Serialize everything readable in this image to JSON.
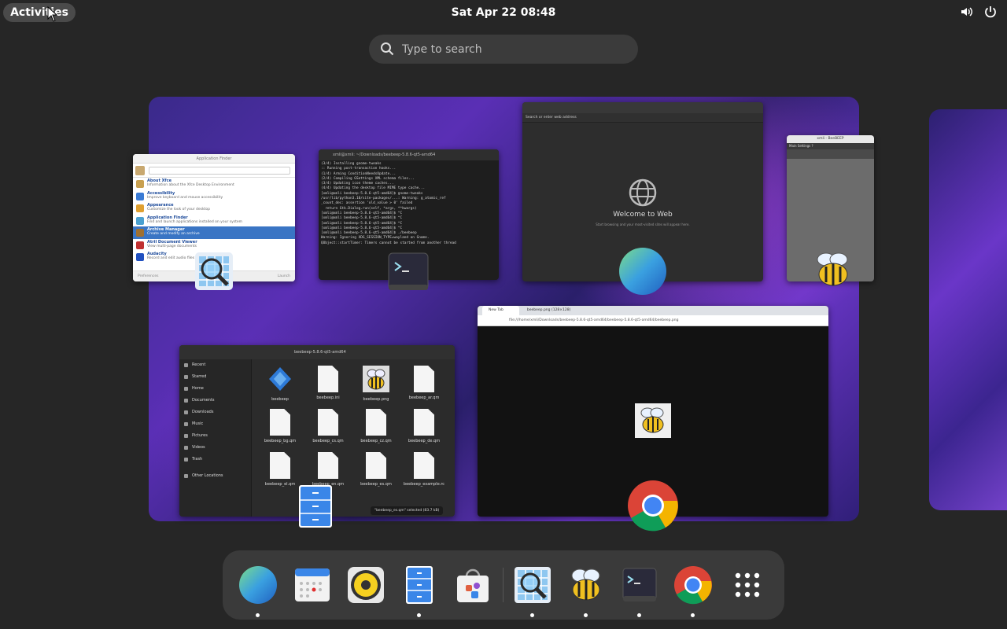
{
  "topbar": {
    "activities_label": "Activities",
    "clock": "Sat Apr 22  08:48",
    "icons": [
      "volume-icon",
      "power-icon"
    ]
  },
  "search": {
    "placeholder": "Type to search"
  },
  "windows": {
    "app_finder": {
      "title": "Application Finder",
      "items": [
        {
          "name": "About Xfce",
          "desc": "Information about the Xfce Desktop Environment",
          "color": "#c8a050"
        },
        {
          "name": "Accessibility",
          "desc": "Improve keyboard and mouse accessibility",
          "color": "#3a7bd5"
        },
        {
          "name": "Appearance",
          "desc": "Customize the look of your desktop",
          "color": "#e0a030"
        },
        {
          "name": "Application Finder",
          "desc": "Find and launch applications installed on your system",
          "color": "#4aa0d0"
        },
        {
          "name": "Archive Manager",
          "desc": "Create and modify an archive",
          "color": "#a07030"
        },
        {
          "name": "Atril Document Viewer",
          "desc": "View multi-page documents",
          "color": "#c03030"
        },
        {
          "name": "Audacity",
          "desc": "Record and edit audio files",
          "color": "#2050c0"
        }
      ],
      "selected_index": 4,
      "footer_left": "Preferences",
      "footer_right": "Launch"
    },
    "terminal": {
      "title": "xmli@xmli: ~/Downloads/beebeep-5.8.6-qt5-amd64",
      "lines": [
        "(3/4) Installing gnome-tweaks",
        ":: Running post-transaction hooks...",
        "(1/4) Arming ConditionNeedsUpdate...",
        "(2/4) Compiling GSettings XML schema files...",
        "(3/4) Updating icon theme caches...",
        "(4/4) Updating the desktop file MIME type cache...",
        "[xmli@xmli beebeep-5.8.6-qt5-amd64]$ gnome-tweaks",
        "/usr/lib/python3.10/site-packages/...: Warning: g_atomic_ref",
        "_count_dec: assertion 'old_value > 0' failed",
        "  return Gtk.Dialog.run(self, *args, **kwargs)",
        "[xmli@xmli beebeep-5.8.6-qt5-amd64]$ ^C",
        "[xmli@xmli beebeep-5.8.6-qt5-amd64]$ ^C",
        "[xmli@xmli beebeep-5.8.6-qt5-amd64]$ ^C",
        "[xmli@xmli beebeep-5.8.6-qt5-amd64]$ ^C",
        "[xmli@xmli beebeep-5.8.6-qt5-amd64]$ ./beebeep",
        "Warning: Ignoring XDG_SESSION_TYPE=wayland on Gnome.",
        "QObject::startTimer: Timers cannot be started from another thread"
      ]
    },
    "web": {
      "url_placeholder": "Search or enter web address",
      "welcome": "Welcome to Web",
      "sub": "Start browsing and your most-visited sites will appear here."
    },
    "beebeep": {
      "title": "xmli - BeeBEEP",
      "menu": "Main   Settings   ?"
    },
    "files": {
      "path": "beebeep-5.8.6-qt5-amd64",
      "sidebar": [
        "Recent",
        "Starred",
        "Home",
        "Documents",
        "Downloads",
        "Music",
        "Pictures",
        "Videos",
        "Trash",
        "Other Locations"
      ],
      "files": [
        {
          "name": "beebeep",
          "kind": "exec"
        },
        {
          "name": "beebeep.ini",
          "kind": "doc"
        },
        {
          "name": "beebeep.png",
          "kind": "image"
        },
        {
          "name": "beebeep_ar.qm",
          "kind": "doc"
        },
        {
          "name": "beebeep_bg.qm",
          "kind": "doc"
        },
        {
          "name": "beebeep_cs.qm",
          "kind": "doc"
        },
        {
          "name": "beebeep_cz.qm",
          "kind": "doc"
        },
        {
          "name": "beebeep_de.qm",
          "kind": "doc"
        },
        {
          "name": "beebeep_el.qm",
          "kind": "doc"
        },
        {
          "name": "beebeep_en.qm",
          "kind": "doc"
        },
        {
          "name": "beebeep_es.qm",
          "kind": "doc"
        },
        {
          "name": "beebeep_example.rc",
          "kind": "text"
        }
      ],
      "status": "\"beebeep_es.qm\" selected (83.7 kB)"
    },
    "chrome": {
      "tabs": [
        "New Tab",
        "beebeep.png (128×128)"
      ],
      "url": "file:///home/xmli/Downloads/beebeep-5.8.6-qt5-amd64/beebeep-5.8.6-qt5-amd64/beebeep.png"
    }
  },
  "dash": {
    "apps": [
      {
        "name": "Web",
        "icon": "web-globe-icon",
        "running": true
      },
      {
        "name": "Calendar",
        "icon": "calendar-icon",
        "running": false
      },
      {
        "name": "Rhythmbox",
        "icon": "speaker-icon",
        "running": false
      },
      {
        "name": "Files",
        "icon": "file-cabinet-icon",
        "running": true
      },
      {
        "name": "Software",
        "icon": "software-bag-icon",
        "running": false
      },
      {
        "name": "Application Finder",
        "icon": "magnifier-icon",
        "running": true
      },
      {
        "name": "BeeBEEP",
        "icon": "bee-icon",
        "running": true
      },
      {
        "name": "Terminal",
        "icon": "terminal-icon",
        "running": true
      },
      {
        "name": "Google Chrome",
        "icon": "chrome-icon",
        "running": true
      },
      {
        "name": "Show Applications",
        "icon": "app-grid-icon",
        "running": false
      }
    ]
  }
}
